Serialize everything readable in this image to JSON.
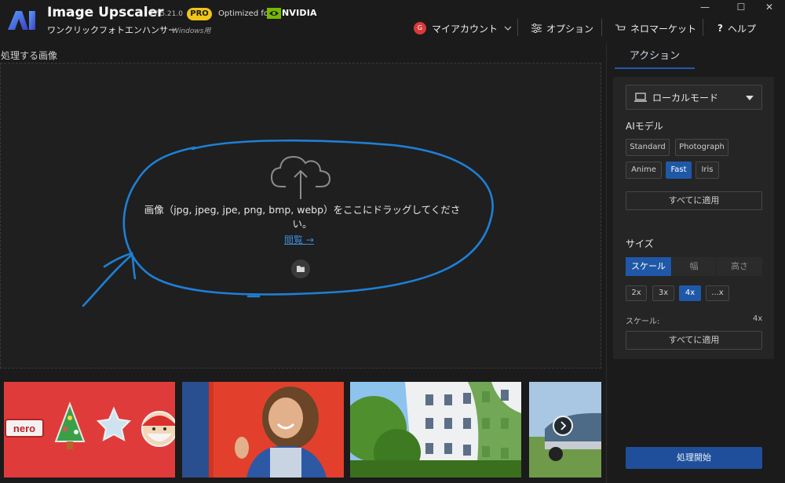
{
  "app": {
    "name": "Image Upscaler",
    "version": "27.5.21.0",
    "badge": "PRO",
    "optimized_for": "Optimized for",
    "partner": "NVIDIA",
    "subtitle": "ワンクリックフォトエンハンサー",
    "subtitle_os": "Windows用",
    "logo_text": "AI"
  },
  "window_controls": [
    "—",
    "☐",
    "✕"
  ],
  "nav": {
    "account_initial": "G",
    "account": "マイアカウント",
    "options": "オプション",
    "market": "ネロマーケット",
    "help_icon": "?",
    "help": "ヘルプ"
  },
  "main": {
    "section_label": "処理する画像",
    "drop_text": "画像（jpg, jpeg, jpe, png, bmp, webp）をここにドラッグしてください。",
    "browse": "閲覧 →"
  },
  "thumbnails": [
    {
      "name": "nero-cookies",
      "nero_label": "nero"
    },
    {
      "name": "woman-smiling"
    },
    {
      "name": "building-ivy"
    },
    {
      "name": "vintage-car"
    }
  ],
  "panel": {
    "tab": "アクション",
    "mode": "ローカルモード",
    "ai_model_label": "AIモデル",
    "models": [
      "Standard",
      "Photograph",
      "Anime",
      "Fast",
      "Iris"
    ],
    "model_selected": "Fast",
    "apply_all": "すべてに適用",
    "size_label": "サイズ",
    "size_tabs": [
      "スケール",
      "幅",
      "高さ"
    ],
    "size_tab_selected": "スケール",
    "scales": [
      "2x",
      "3x",
      "4x",
      "...x"
    ],
    "scale_selected": "4x",
    "scale_label": "スケール:",
    "scale_value": "4x",
    "apply_all_2": "すべてに適用",
    "start": "処理開始"
  },
  "colors": {
    "accent": "#2058a8",
    "badge": "#f0c419",
    "annotation": "#1f7fd6",
    "link": "#3c8dde"
  }
}
